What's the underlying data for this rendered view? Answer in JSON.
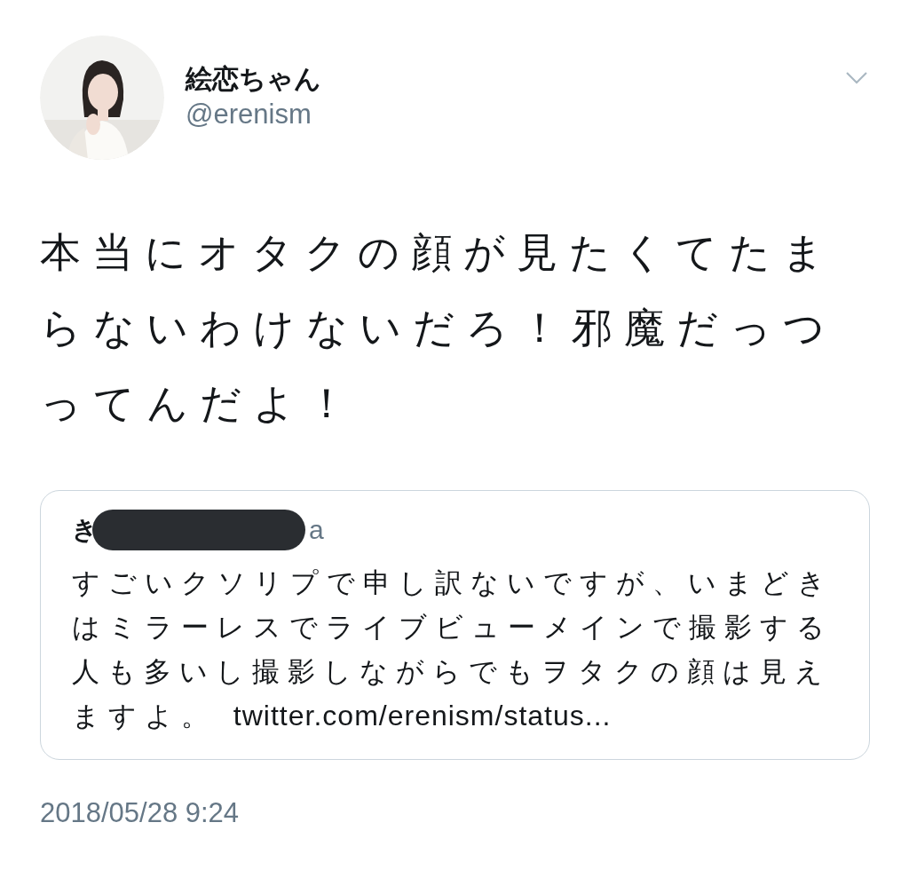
{
  "tweet": {
    "author": {
      "name": "絵恋ちゃん",
      "handle": "@erenism"
    },
    "text": "本当にオタクの顔が見たくてたまらないわけないだろ！邪魔だっつってんだよ！",
    "quoted": {
      "name_visible": "き",
      "redacted": true,
      "handle_visible": "a",
      "text": "すごいクソリプで申し訳ないですが、いまどきはミラーレスでライブビューメインで撮影する人も多いし撮影しながらでもヲタクの顔は見えますよ。",
      "link": "twitter.com/erenism/status..."
    },
    "timestamp": "2018/05/28 9:24"
  }
}
